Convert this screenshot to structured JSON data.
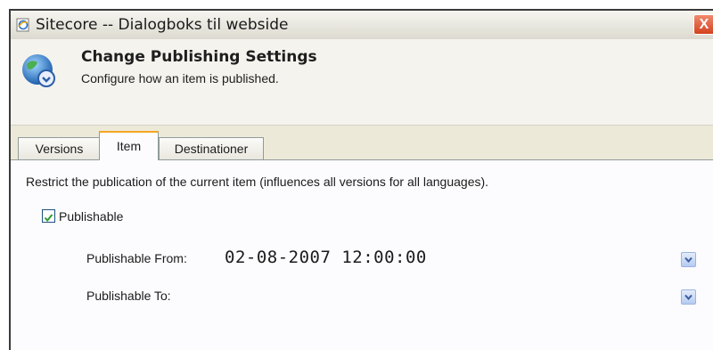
{
  "window": {
    "title": "Sitecore -- Dialogboks til webside",
    "close_glyph": "X"
  },
  "header": {
    "title": "Change Publishing Settings",
    "subtitle": "Configure how an item is published.",
    "icon": "globe-publish-icon"
  },
  "tabs": [
    {
      "label": "Versions",
      "active": false
    },
    {
      "label": "Item",
      "active": true
    },
    {
      "label": "Destinationer",
      "active": false
    }
  ],
  "item_tab": {
    "description": "Restrict the publication of the current item (influences all versions for all languages).",
    "publishable_label": "Publishable",
    "publishable_checked": true,
    "from_label": "Publishable From:",
    "from_value": "02-08-2007 12:00:00",
    "to_label": "Publishable To:",
    "to_value": ""
  },
  "colors": {
    "accent_tab": "#f5a623",
    "close_button": "#d2421f",
    "check": "#2e9a2e"
  }
}
